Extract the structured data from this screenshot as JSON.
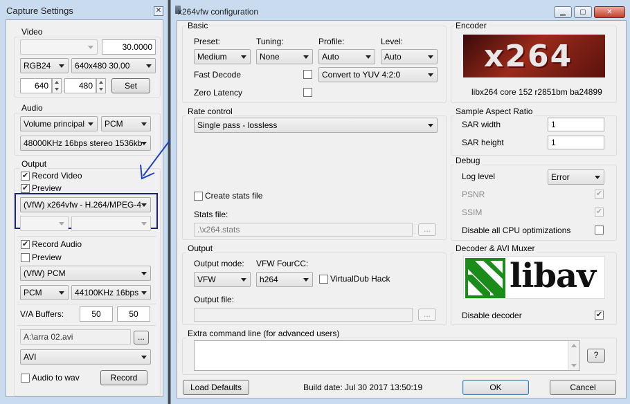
{
  "capture": {
    "title": "Capture Settings",
    "video": {
      "group": "Video",
      "device": "",
      "fps": "30.0000",
      "colorspace": "RGB24",
      "resolution": "640x480 30.00",
      "width": "640",
      "height": "480",
      "set_label": "Set"
    },
    "audio": {
      "group": "Audio",
      "source": "Volume principal",
      "codec": "PCM",
      "format": "48000KHz 16bps stereo 1536kb"
    },
    "output": {
      "group": "Output",
      "record_video_label": "Record Video",
      "record_video_checked": true,
      "preview_video_label": "Preview",
      "preview_video_checked": true,
      "video_codec": "(VfW) x264vfw - H.264/MPEG-4",
      "codec_opt1": "",
      "codec_opt2": "",
      "record_audio_label": "Record Audio",
      "record_audio_checked": true,
      "preview_audio_label": "Preview",
      "preview_audio_checked": false,
      "audio_codec": "(VfW) PCM",
      "audio_type": "PCM",
      "audio_rate": "44100KHz 16bps",
      "va_buffers_label": "V/A Buffers:",
      "va_buffer_1": "50",
      "va_buffer_2": "50",
      "file_path": "A:\\arra 02.avi",
      "browse_label": "...",
      "container": "AVI",
      "audio_to_wav_label": "Audio to wav",
      "record_label": "Record"
    },
    "highlight_color": "#1a237e"
  },
  "x264": {
    "title": "x264vfw configuration",
    "basic": {
      "group": "Basic",
      "preset_label": "Preset:",
      "preset": "Medium",
      "tuning_label": "Tuning:",
      "tuning": "None",
      "profile_label": "Profile:",
      "profile": "Auto",
      "level_label": "Level:",
      "level": "Auto",
      "fast_decode_label": "Fast Decode",
      "zero_latency_label": "Zero Latency",
      "colorspace": "Convert to YUV 4:2:0"
    },
    "encoder": {
      "group": "Encoder",
      "logo_text": "x264",
      "version": "libx264 core 152 r2851bm ba24899"
    },
    "rate": {
      "group": "Rate control",
      "mode": "Single pass - lossless",
      "create_stats_label": "Create stats file",
      "stats_file_label": "Stats file:",
      "stats_file": ".\\x264.stats",
      "browse_label": "..."
    },
    "sar": {
      "group": "Sample Aspect Ratio",
      "width_label": "SAR width",
      "width": "1",
      "height_label": "SAR height",
      "height": "1"
    },
    "debug": {
      "group": "Debug",
      "log_level_label": "Log level",
      "log_level": "Error",
      "psnr_label": "PSNR",
      "ssim_label": "SSIM",
      "disable_cpu_label": "Disable all CPU optimizations"
    },
    "output": {
      "group": "Output",
      "mode_label": "Output mode:",
      "mode": "VFW",
      "fourcc_label": "VFW FourCC:",
      "fourcc": "h264",
      "vdub_hack_label": "VirtualDub Hack",
      "file_label": "Output file:",
      "file": "",
      "browse_label": "..."
    },
    "decoder": {
      "group": "Decoder & AVI Muxer",
      "logo_text": "libav",
      "disable_decoder_label": "Disable decoder"
    },
    "extra": {
      "group": "Extra command line (for advanced users)",
      "value": "",
      "help_label": "?"
    },
    "footer": {
      "load_defaults_label": "Load Defaults",
      "build_date": "Build date: Jul 30 2017 13:50:19",
      "ok_label": "OK",
      "cancel_label": "Cancel"
    }
  },
  "annotation_color": "#1e40c8"
}
